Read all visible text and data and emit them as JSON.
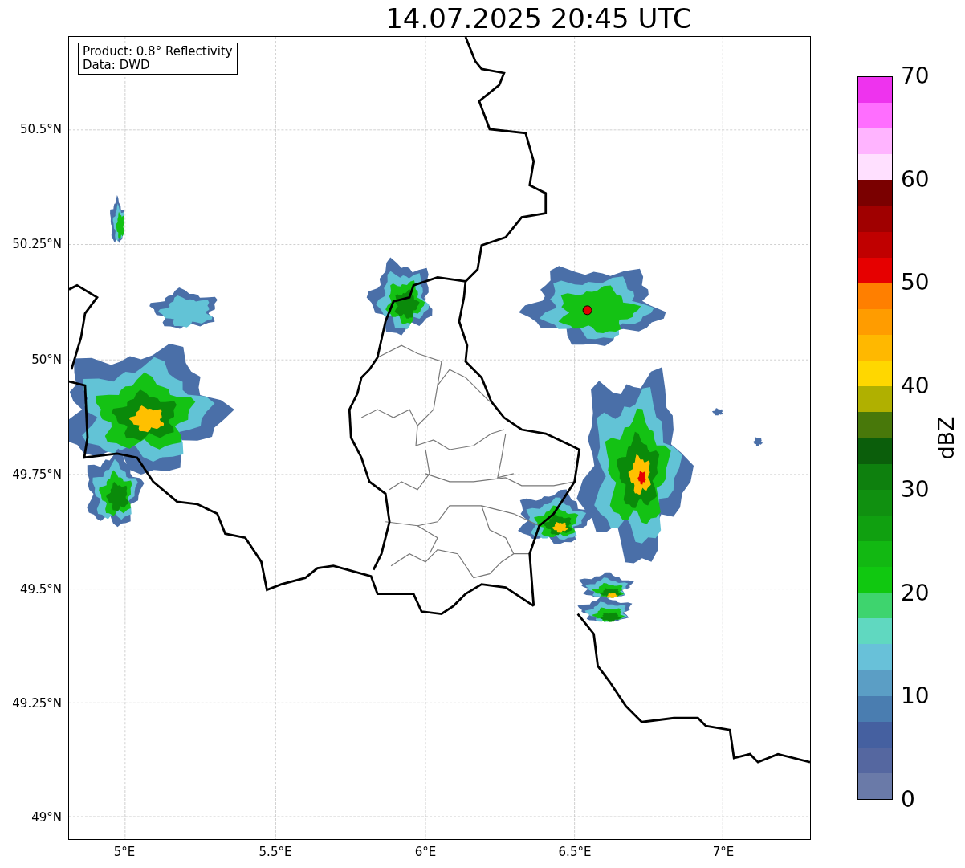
{
  "title": "14.07.2025 20:45 UTC",
  "legend": {
    "lines": [
      "Product: 0.8° Reflectivity",
      "Data: DWD"
    ]
  },
  "map": {
    "lat_ticks": [
      "50.5°N",
      "50.25°N",
      "50°N",
      "49.75°N",
      "49.5°N",
      "49.25°N",
      "49°N"
    ],
    "lon_ticks": [
      "5°E",
      "5.5°E",
      "6°E",
      "6.5°E",
      "7°E"
    ]
  },
  "colorbar": {
    "label": "dBZ",
    "ticks": [
      "70",
      "60",
      "50",
      "40",
      "30",
      "20",
      "10",
      "0"
    ],
    "segments": [
      {
        "color": "#6a7aa8"
      },
      {
        "color": "#5567a0"
      },
      {
        "color": "#4560a0"
      },
      {
        "color": "#4a7db0"
      },
      {
        "color": "#5b9ec5"
      },
      {
        "color": "#68c1d9"
      },
      {
        "color": "#60d8c0"
      },
      {
        "color": "#3ed46e"
      },
      {
        "color": "#10c810"
      },
      {
        "color": "#12b812"
      },
      {
        "color": "#10a010"
      },
      {
        "color": "#109010"
      },
      {
        "color": "#0e800e"
      },
      {
        "color": "#0b5e0b"
      },
      {
        "color": "#48780a"
      },
      {
        "color": "#b0b000"
      },
      {
        "color": "#ffd700"
      },
      {
        "color": "#ffb800"
      },
      {
        "color": "#ff9c00"
      },
      {
        "color": "#ff7f00"
      },
      {
        "color": "#e60000"
      },
      {
        "color": "#c00000"
      },
      {
        "color": "#a00000"
      },
      {
        "color": "#7a0000"
      },
      {
        "color": "#ffe0ff"
      },
      {
        "color": "#ffb4ff"
      },
      {
        "color": "#ff6eff"
      },
      {
        "color": "#ee33ee"
      }
    ]
  }
}
